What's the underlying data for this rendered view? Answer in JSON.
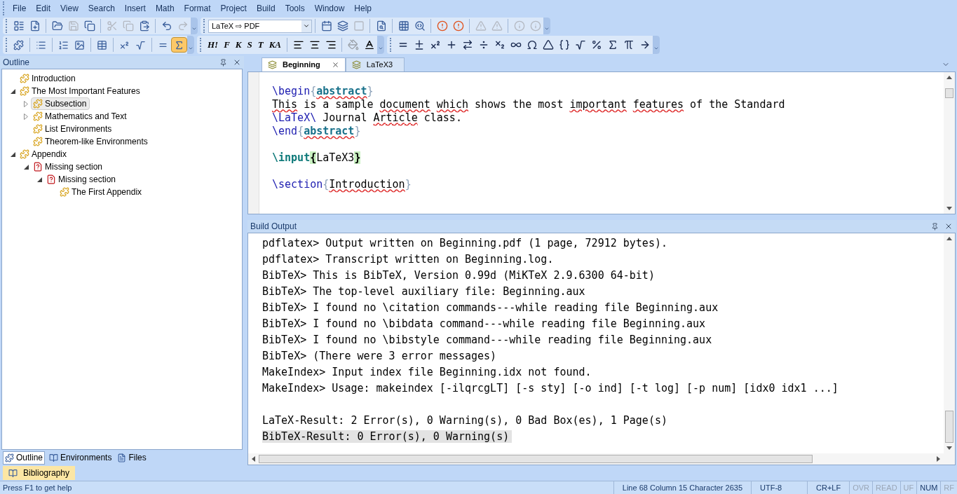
{
  "menu": [
    "File",
    "Edit",
    "View",
    "Search",
    "Insert",
    "Math",
    "Format",
    "Project",
    "Build",
    "Tools",
    "Window",
    "Help"
  ],
  "toolbar_1": {
    "groups_left": [
      [
        {
          "disabled": false
        },
        {
          "disabled": false
        }
      ],
      [
        {
          "disabled": false
        },
        {
          "disabled": true
        },
        {
          "disabled": false
        }
      ],
      [
        {
          "disabled": true
        },
        {
          "disabled": true
        },
        {
          "disabled": false
        }
      ],
      [
        {
          "disabled": false
        },
        {
          "disabled": true
        }
      ]
    ],
    "build_profile": "LaTeX ⇨ PDF",
    "groups_right": [
      [
        {
          "disabled": false
        },
        {
          "disabled": false
        },
        {
          "disabled": true
        }
      ],
      [
        {
          "disabled": false
        }
      ],
      [
        {
          "disabled": false
        },
        {
          "disabled": false
        }
      ],
      [
        {
          "disabled": false
        },
        {
          "disabled": false
        }
      ],
      [
        {
          "disabled": true
        },
        {
          "disabled": true
        }
      ],
      [
        {
          "disabled": true
        },
        {
          "disabled": true
        }
      ]
    ]
  },
  "toolbar_2": {
    "structure": [
      {
        "selected": false
      },
      {
        "selected": false
      },
      {
        "selected": false
      },
      {
        "selected": false
      },
      {
        "selected": false
      },
      {
        "selected": false
      },
      {
        "selected": false
      },
      {
        "selected": false
      },
      {
        "selected": true
      }
    ],
    "format_buttons": [
      "H!",
      "F",
      "K",
      "S",
      "T",
      "KA"
    ]
  },
  "outline_panel": {
    "title": "Outline",
    "items": [
      {
        "label": "Introduction",
        "kind": "section",
        "selected": false
      },
      {
        "label": "The Most Important Features",
        "kind": "section",
        "selected": false,
        "expanded": true,
        "children": [
          {
            "label": "Subsection",
            "kind": "section",
            "selected": true,
            "expanded": false
          },
          {
            "label": "Mathematics and Text",
            "kind": "section",
            "selected": false,
            "expanded": false
          },
          {
            "label": "List Environments",
            "kind": "section",
            "selected": false
          },
          {
            "label": "Theorem-like Environments",
            "kind": "section",
            "selected": false
          }
        ]
      },
      {
        "label": "Appendix",
        "kind": "section",
        "selected": false,
        "expanded": true,
        "children": [
          {
            "label": "Missing section",
            "kind": "missing",
            "selected": false,
            "expanded": true,
            "children": [
              {
                "label": "Missing section",
                "kind": "missing",
                "selected": false,
                "expanded": true,
                "children": [
                  {
                    "label": "The First Appendix",
                    "kind": "section",
                    "selected": false
                  }
                ]
              }
            ]
          }
        ]
      }
    ],
    "tabs": [
      {
        "label": "Outline",
        "selected": true
      },
      {
        "label": "Environments",
        "selected": false
      },
      {
        "label": "Files",
        "selected": false
      }
    ]
  },
  "side_tab": "Bibliography",
  "editor": {
    "tabs": [
      {
        "label": "Beginning",
        "selected": true
      },
      {
        "label": "LaTeX3",
        "selected": false
      }
    ],
    "lines": [
      {
        "kind": "code",
        "tokens": [
          {
            "text": "\\begin",
            "kind": "cmd"
          },
          {
            "text": "{",
            "kind": "brace"
          },
          {
            "text": "abstract",
            "kind": "arg"
          },
          {
            "text": "}",
            "kind": "brace"
          }
        ]
      },
      {
        "kind": "code",
        "tokens": [
          {
            "text": "This",
            "kind": "spell"
          },
          {
            "text": " is a sample ",
            "kind": "plain"
          },
          {
            "text": "document which",
            "kind": "spell"
          },
          {
            "text": " shows the most ",
            "kind": "plain"
          },
          {
            "text": "important features",
            "kind": "spell"
          },
          {
            "text": " of the Standard",
            "kind": "plain"
          }
        ]
      },
      {
        "kind": "code",
        "tokens": [
          {
            "text": "\\LaTeX\\",
            "kind": "cmd"
          },
          {
            "text": " Journal ",
            "kind": "plain"
          },
          {
            "text": "Article",
            "kind": "spell"
          },
          {
            "text": " class.",
            "kind": "plain"
          }
        ]
      },
      {
        "kind": "code",
        "tokens": [
          {
            "text": "\\end",
            "kind": "cmd"
          },
          {
            "text": "{",
            "kind": "brace"
          },
          {
            "text": "abstract",
            "kind": "arg"
          },
          {
            "text": "}",
            "kind": "brace"
          }
        ]
      },
      {
        "kind": "blank"
      },
      {
        "kind": "code",
        "tokens": [
          {
            "text": "\\input",
            "kind": "cmdbold"
          },
          {
            "text": "{",
            "kind": "match"
          },
          {
            "text": "LaTeX3",
            "kind": "plain"
          },
          {
            "text": "}",
            "kind": "match"
          }
        ]
      },
      {
        "kind": "blank"
      },
      {
        "kind": "code",
        "tokens": [
          {
            "text": "\\section",
            "kind": "cmd"
          },
          {
            "text": "{",
            "kind": "brace"
          },
          {
            "text": "Introduction",
            "kind": "spell"
          },
          {
            "text": "}",
            "kind": "brace"
          }
        ]
      }
    ]
  },
  "build_output": {
    "title": "Build Output",
    "lines": [
      {
        "kind": "message",
        "text": "pdflatex> Output written on Beginning.pdf (1 page, 72912 bytes).",
        "selected": false
      },
      {
        "kind": "message",
        "text": "pdflatex> Transcript written on Beginning.log.",
        "selected": false
      },
      {
        "kind": "message",
        "text": "BibTeX> This is BibTeX, Version 0.99d (MiKTeX 2.9.6300 64-bit)",
        "selected": false
      },
      {
        "kind": "message",
        "text": "BibTeX> The top-level auxiliary file: Beginning.aux",
        "selected": false
      },
      {
        "kind": "message",
        "text": "BibTeX> I found no \\citation commands---while reading file Beginning.aux",
        "selected": false
      },
      {
        "kind": "message",
        "text": "BibTeX> I found no \\bibdata command---while reading file Beginning.aux",
        "selected": false
      },
      {
        "kind": "message",
        "text": "BibTeX> I found no \\bibstyle command---while reading file Beginning.aux",
        "selected": false
      },
      {
        "kind": "message",
        "text": "BibTeX> (There were 3 error messages)",
        "selected": false
      },
      {
        "kind": "message",
        "text": "MakeIndex> Input index file Beginning.idx not found.",
        "selected": false
      },
      {
        "kind": "message",
        "text": "MakeIndex> Usage: makeindex [-ilqrcgLT] [-s sty] [-o ind] [-t log] [-p num] [idx0 idx1 ...]",
        "selected": false
      },
      {
        "kind": "blank"
      },
      {
        "kind": "message",
        "text": "LaTeX-Result: 2 Error(s), 0 Warning(s), 0 Bad Box(es), 1 Page(s)",
        "selected": false
      },
      {
        "kind": "message",
        "text": "BibTeX-Result: 0 Error(s), 0 Warning(s)",
        "selected": true
      }
    ]
  },
  "status_bar": {
    "help": "Press F1 to get help",
    "position": "Line 68 Column 15 Character 2635",
    "encoding": "UTF-8",
    "line_end": "CR+LF",
    "indicators": [
      {
        "label": "OVR",
        "on": false
      },
      {
        "label": "READ",
        "on": false
      },
      {
        "label": "UF",
        "on": false
      },
      {
        "label": "NUM",
        "on": true
      },
      {
        "label": "RF",
        "on": false
      }
    ]
  }
}
